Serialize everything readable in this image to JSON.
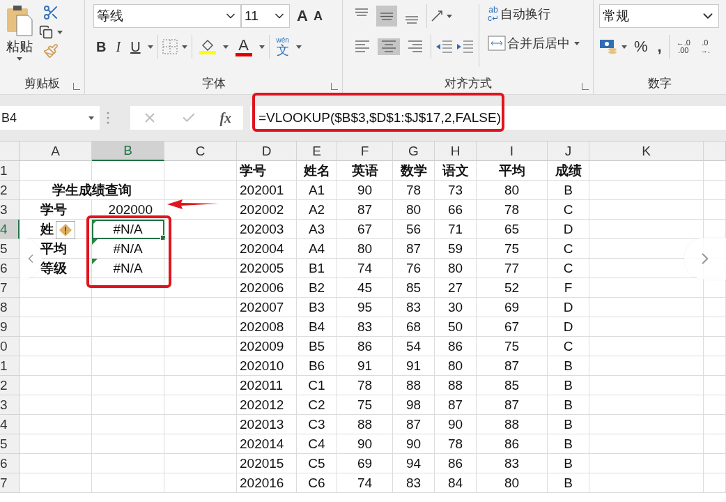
{
  "clipboard": {
    "paste_label": "粘贴",
    "group_label": "剪贴板"
  },
  "font": {
    "name": "等线",
    "size": "11",
    "grow": "A",
    "shrink": "A",
    "bold": "B",
    "italic": "I",
    "underline": "U",
    "font_color_glyph": "A",
    "phonetic_top": "wén",
    "phonetic": "文",
    "group_label": "字体"
  },
  "alignment": {
    "vertical": [
      {
        "selected": false
      },
      {
        "selected": true
      },
      {
        "selected": false
      }
    ],
    "horizontal": [
      {
        "selected": false
      },
      {
        "selected": true
      },
      {
        "selected": false
      }
    ],
    "wrap_icon": [
      "ab",
      "c↵"
    ],
    "wrap_text": "自动换行",
    "merge": "合并后居中",
    "group_label": "对齐方式"
  },
  "number": {
    "format": "常规",
    "percent": "%",
    "comma": ",",
    "decrease_decimal": [
      "←.0",
      ".00"
    ],
    "increase_decimal": [
      ".0",
      "→."
    ],
    "group_label": "数字"
  },
  "formula_bar": {
    "name_box": "B4",
    "fx": "fx",
    "formula": "=VLOOKUP($B$3,$D$1:$J$17,2,FALSE)"
  },
  "sheet": {
    "columns": [
      {
        "label": "A",
        "selected": false
      },
      {
        "label": "B",
        "selected": true
      },
      {
        "label": "C",
        "selected": false
      },
      {
        "label": "D",
        "selected": false
      },
      {
        "label": "E",
        "selected": false
      },
      {
        "label": "F",
        "selected": false
      },
      {
        "label": "G",
        "selected": false
      },
      {
        "label": "H",
        "selected": false
      },
      {
        "label": "I",
        "selected": false
      },
      {
        "label": "J",
        "selected": false
      },
      {
        "label": "K",
        "selected": false
      }
    ],
    "rows": [
      {
        "label": "1",
        "selected": false
      },
      {
        "label": "2",
        "selected": false
      },
      {
        "label": "3",
        "selected": false
      },
      {
        "label": "4",
        "selected": true
      },
      {
        "label": "5",
        "selected": false
      },
      {
        "label": "6",
        "selected": false
      },
      {
        "label": "7",
        "selected": false
      },
      {
        "label": "8",
        "selected": false
      },
      {
        "label": "9",
        "selected": false
      },
      {
        "label": "0",
        "selected": false
      },
      {
        "label": "1",
        "selected": false
      },
      {
        "label": "2",
        "selected": false
      },
      {
        "label": "3",
        "selected": false
      },
      {
        "label": "4",
        "selected": false
      },
      {
        "label": "5",
        "selected": false
      },
      {
        "label": "6",
        "selected": false
      },
      {
        "label": "7",
        "selected": false
      }
    ]
  },
  "query": {
    "title": "学生成绩查询",
    "fields": [
      {
        "label": "学号",
        "value": "202000",
        "error": false,
        "selected": false,
        "warning": false
      },
      {
        "label": "姓",
        "value": "#N/A",
        "error": true,
        "selected": true,
        "warning": true
      },
      {
        "label": "平均",
        "value": "#N/A",
        "error": true,
        "selected": false,
        "warning": false
      },
      {
        "label": "等级",
        "value": "#N/A",
        "error": true,
        "selected": false,
        "warning": false
      }
    ]
  },
  "scores": {
    "columns": [
      "学号",
      "姓名",
      "英语",
      "数学",
      "语文",
      "平均",
      "成绩"
    ],
    "rows": [
      [
        "202001",
        "A1",
        "90",
        "78",
        "73",
        "80",
        "B"
      ],
      [
        "202002",
        "A2",
        "87",
        "80",
        "66",
        "78",
        "C"
      ],
      [
        "202003",
        "A3",
        "67",
        "56",
        "71",
        "65",
        "D"
      ],
      [
        "202004",
        "A4",
        "80",
        "87",
        "59",
        "75",
        "C"
      ],
      [
        "202005",
        "B1",
        "74",
        "76",
        "80",
        "77",
        "C"
      ],
      [
        "202006",
        "B2",
        "45",
        "85",
        "27",
        "52",
        "F"
      ],
      [
        "202007",
        "B3",
        "95",
        "83",
        "30",
        "69",
        "D"
      ],
      [
        "202008",
        "B4",
        "83",
        "68",
        "50",
        "67",
        "D"
      ],
      [
        "202009",
        "B5",
        "86",
        "54",
        "86",
        "75",
        "C"
      ],
      [
        "202010",
        "B6",
        "91",
        "91",
        "80",
        "87",
        "B"
      ],
      [
        "202011",
        "C1",
        "78",
        "88",
        "88",
        "85",
        "B"
      ],
      [
        "202012",
        "C2",
        "75",
        "98",
        "87",
        "87",
        "B"
      ],
      [
        "202013",
        "C3",
        "88",
        "87",
        "90",
        "88",
        "B"
      ],
      [
        "202014",
        "C4",
        "90",
        "90",
        "78",
        "86",
        "B"
      ],
      [
        "202015",
        "C5",
        "69",
        "94",
        "86",
        "83",
        "B"
      ],
      [
        "202016",
        "C6",
        "74",
        "83",
        "84",
        "80",
        "B"
      ]
    ]
  }
}
